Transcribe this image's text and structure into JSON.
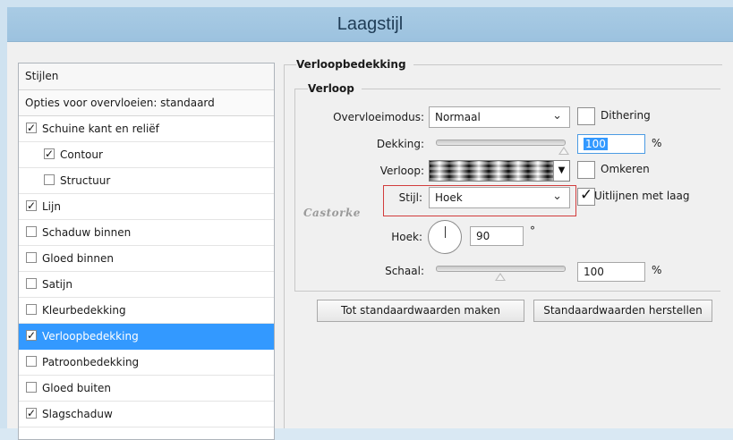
{
  "window": {
    "title": "Laagstijl"
  },
  "styles_list": {
    "header": "Stijlen",
    "blend_options": "Opties voor overvloeien: standaard",
    "items": [
      {
        "label": "Schuine kant en reliëf",
        "checked": true,
        "indent": 0,
        "selected": false
      },
      {
        "label": "Contour",
        "checked": true,
        "indent": 1,
        "selected": false
      },
      {
        "label": "Structuur",
        "checked": false,
        "indent": 1,
        "selected": false
      },
      {
        "label": "Lijn",
        "checked": true,
        "indent": 0,
        "selected": false
      },
      {
        "label": "Schaduw binnen",
        "checked": false,
        "indent": 0,
        "selected": false
      },
      {
        "label": "Gloed binnen",
        "checked": false,
        "indent": 0,
        "selected": false
      },
      {
        "label": "Satijn",
        "checked": false,
        "indent": 0,
        "selected": false
      },
      {
        "label": "Kleurbedekking",
        "checked": false,
        "indent": 0,
        "selected": false
      },
      {
        "label": "Verloopbedekking",
        "checked": true,
        "indent": 0,
        "selected": true
      },
      {
        "label": "Patroonbedekking",
        "checked": false,
        "indent": 0,
        "selected": false
      },
      {
        "label": "Gloed buiten",
        "checked": false,
        "indent": 0,
        "selected": false
      },
      {
        "label": "Slagschaduw",
        "checked": true,
        "indent": 0,
        "selected": false
      }
    ]
  },
  "panel": {
    "section_title": "Verloopbedekking",
    "group_title": "Verloop",
    "blend_mode": {
      "label": "Overvloeimodus:",
      "value": "Normaal"
    },
    "dithering": {
      "label": "Dithering",
      "checked": false
    },
    "opacity": {
      "label": "Dekking:",
      "value": "100",
      "unit": "%",
      "level": 1.0
    },
    "gradient": {
      "label": "Verloop:"
    },
    "reverse": {
      "label": "Omkeren",
      "checked": false
    },
    "style": {
      "label": "Stijl:",
      "value": "Hoek"
    },
    "align": {
      "label": "Uitlijnen met laag",
      "checked": true
    },
    "angle": {
      "label": "Hoek:",
      "value": "90",
      "unit": "°"
    },
    "scale": {
      "label": "Schaal:",
      "value": "100",
      "unit": "%",
      "level": 0.5
    },
    "watermark": "Castorke",
    "buttons": {
      "reset_default": "Tot standaardwaarden maken",
      "restore_default": "Standaardwaarden herstellen"
    }
  },
  "colors": {
    "selection": "#3399ff",
    "title_bar": "#a9cbe4",
    "highlight_box": "#d23c3c"
  }
}
